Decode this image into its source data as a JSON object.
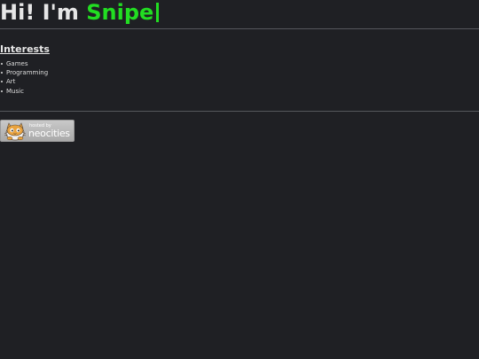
{
  "header": {
    "greeting": "Hi! I'm ",
    "name": "Snipe"
  },
  "interests": {
    "heading": "Interests",
    "items": [
      "Games",
      "Programming",
      "Art",
      "Music"
    ]
  },
  "badge": {
    "hosted_text": "hosted by",
    "brand_text": "neocities",
    "icon": "neocities-cat-icon"
  },
  "colors": {
    "background": "#1f2024",
    "accent": "#22dd22",
    "text": "#e6e6e6"
  }
}
